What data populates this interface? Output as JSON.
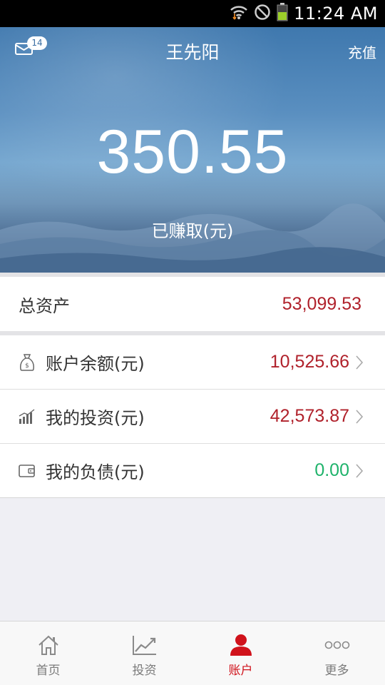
{
  "status_bar": {
    "time": "11:24 AM",
    "icons": [
      "wifi-icon",
      "no-disturb-icon",
      "battery-icon"
    ]
  },
  "header": {
    "title": "王先阳",
    "mail_badge": "14",
    "recharge_label": "充值"
  },
  "earnings": {
    "amount": "350.55",
    "label": "已赚取(元)"
  },
  "total_assets": {
    "label": "总资产",
    "value": "53,099.53"
  },
  "accounts": [
    {
      "label": "账户余额(元)",
      "value": "10,525.66",
      "icon": "money-bag-icon",
      "color": "#b0212b"
    },
    {
      "label": "我的投资(元)",
      "value": "42,573.87",
      "icon": "bar-chart-icon",
      "color": "#b0212b"
    },
    {
      "label": "我的负债(元)",
      "value": "0.00",
      "icon": "wallet-icon",
      "color": "#1fb36b"
    }
  ],
  "bottom_nav": [
    {
      "label": "首页",
      "icon": "home-icon",
      "active": false
    },
    {
      "label": "投资",
      "icon": "trend-chart-icon",
      "active": false
    },
    {
      "label": "账户",
      "icon": "user-icon",
      "active": true
    },
    {
      "label": "更多",
      "icon": "more-icon",
      "active": false
    }
  ],
  "colors": {
    "accent_red": "#d0121b",
    "value_red": "#b0212b",
    "value_green": "#1fb36b"
  }
}
